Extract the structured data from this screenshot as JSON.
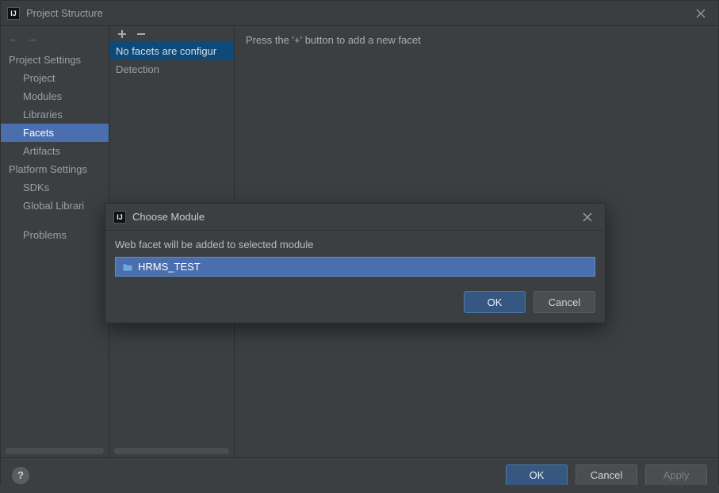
{
  "window": {
    "title": "Project Structure"
  },
  "sidebar": {
    "nav_back": "←",
    "nav_fwd": "→",
    "sections": [
      {
        "header": "Project Settings",
        "items": [
          {
            "label": "Project",
            "selected": false
          },
          {
            "label": "Modules",
            "selected": false
          },
          {
            "label": "Libraries",
            "selected": false
          },
          {
            "label": "Facets",
            "selected": true
          },
          {
            "label": "Artifacts",
            "selected": false
          }
        ]
      },
      {
        "header": "Platform Settings",
        "items": [
          {
            "label": "SDKs",
            "selected": false
          },
          {
            "label": "Global Librari",
            "selected": false
          }
        ]
      }
    ],
    "problems_label": "Problems"
  },
  "middle": {
    "rows": [
      {
        "label": "No facets are configur",
        "selected": true
      },
      {
        "label": "Detection",
        "selected": false
      }
    ]
  },
  "content": {
    "hint": "Press the '+' button to add a new facet"
  },
  "footer": {
    "help_label": "?",
    "ok_label": "OK",
    "cancel_label": "Cancel",
    "apply_label": "Apply"
  },
  "modal": {
    "title": "Choose Module",
    "message": "Web facet will be added to selected module",
    "module_name": "HRMS_TEST",
    "ok_label": "OK",
    "cancel_label": "Cancel"
  }
}
